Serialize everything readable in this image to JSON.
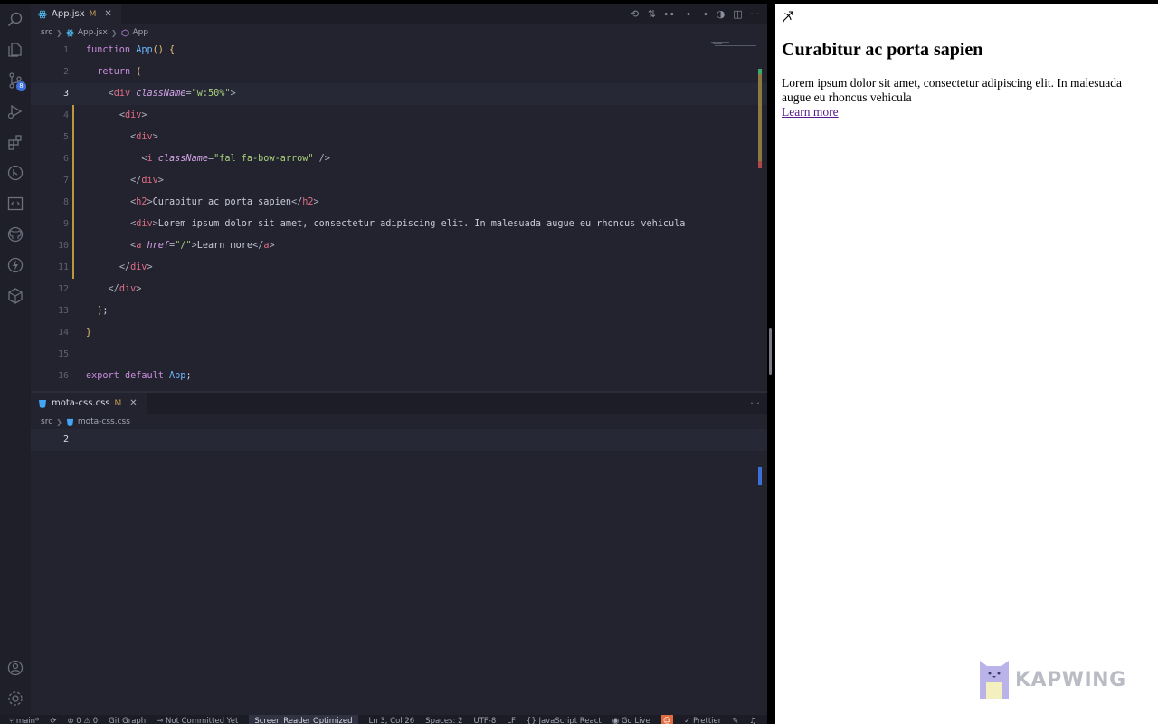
{
  "top_tab": {
    "filename": "App.jsx",
    "modified": "M",
    "close": "✕"
  },
  "top_breadcrumb": {
    "folder": "src",
    "file": "App.jsx",
    "symbol": "App"
  },
  "bottom_tab": {
    "filename": "mota-css.css",
    "modified": "M",
    "close": "✕"
  },
  "bottom_breadcrumb": {
    "folder": "src",
    "file": "mota-css.css"
  },
  "more_actions": "···",
  "scm_badge": "8",
  "code_lines": [
    {
      "n": "1",
      "text": "function App() {"
    },
    {
      "n": "2",
      "text": "  return ("
    },
    {
      "n": "3",
      "text": "    <div className=\"w:50%\">"
    },
    {
      "n": "4",
      "text": "      <div>"
    },
    {
      "n": "5",
      "text": "        <div>"
    },
    {
      "n": "6",
      "text": "          <i className=\"fal fa-bow-arrow\" />"
    },
    {
      "n": "7",
      "text": "        </div>"
    },
    {
      "n": "8",
      "text": "        <h2>Curabitur ac porta sapien</h2>"
    },
    {
      "n": "9",
      "text": "        <div>Lorem ipsum dolor sit amet, consectetur adipiscing elit. In malesuada augue eu rhoncus vehicula"
    },
    {
      "n": "10",
      "text": "        <a href=\"/\">Learn more</a>"
    },
    {
      "n": "11",
      "text": "      </div>"
    },
    {
      "n": "12",
      "text": "    </div>"
    },
    {
      "n": "13",
      "text": "  );"
    },
    {
      "n": "14",
      "text": "}"
    },
    {
      "n": "15",
      "text": ""
    },
    {
      "n": "16",
      "text": "export default App;"
    }
  ],
  "css_lines": [
    {
      "n": "2",
      "text": ""
    }
  ],
  "status": {
    "branch": "main*",
    "errors": "0",
    "warnings": "0",
    "git_graph": "Git Graph",
    "commit": "Not Committed Yet",
    "screen_reader": "Screen Reader Optimized",
    "position": "Ln 3, Col 26",
    "spaces": "Spaces: 2",
    "encoding": "UTF-8",
    "eol": "LF",
    "language": "JavaScript React",
    "go_live": "Go Live",
    "prettier": "Prettier"
  },
  "preview": {
    "heading": "Curabitur ac porta sapien",
    "body": "Lorem ipsum dolor sit amet, consectetur adipiscing elit. In malesuada augue eu rhoncus vehicula",
    "link": "Learn more"
  },
  "watermark": "KAPWING",
  "colors": {
    "editor_bg": "#22232e",
    "keyword": "#c98cdc",
    "function": "#6cb6ff",
    "tag": "#e06c85",
    "string": "#a8cf7b",
    "accent": "#e06b3e"
  }
}
